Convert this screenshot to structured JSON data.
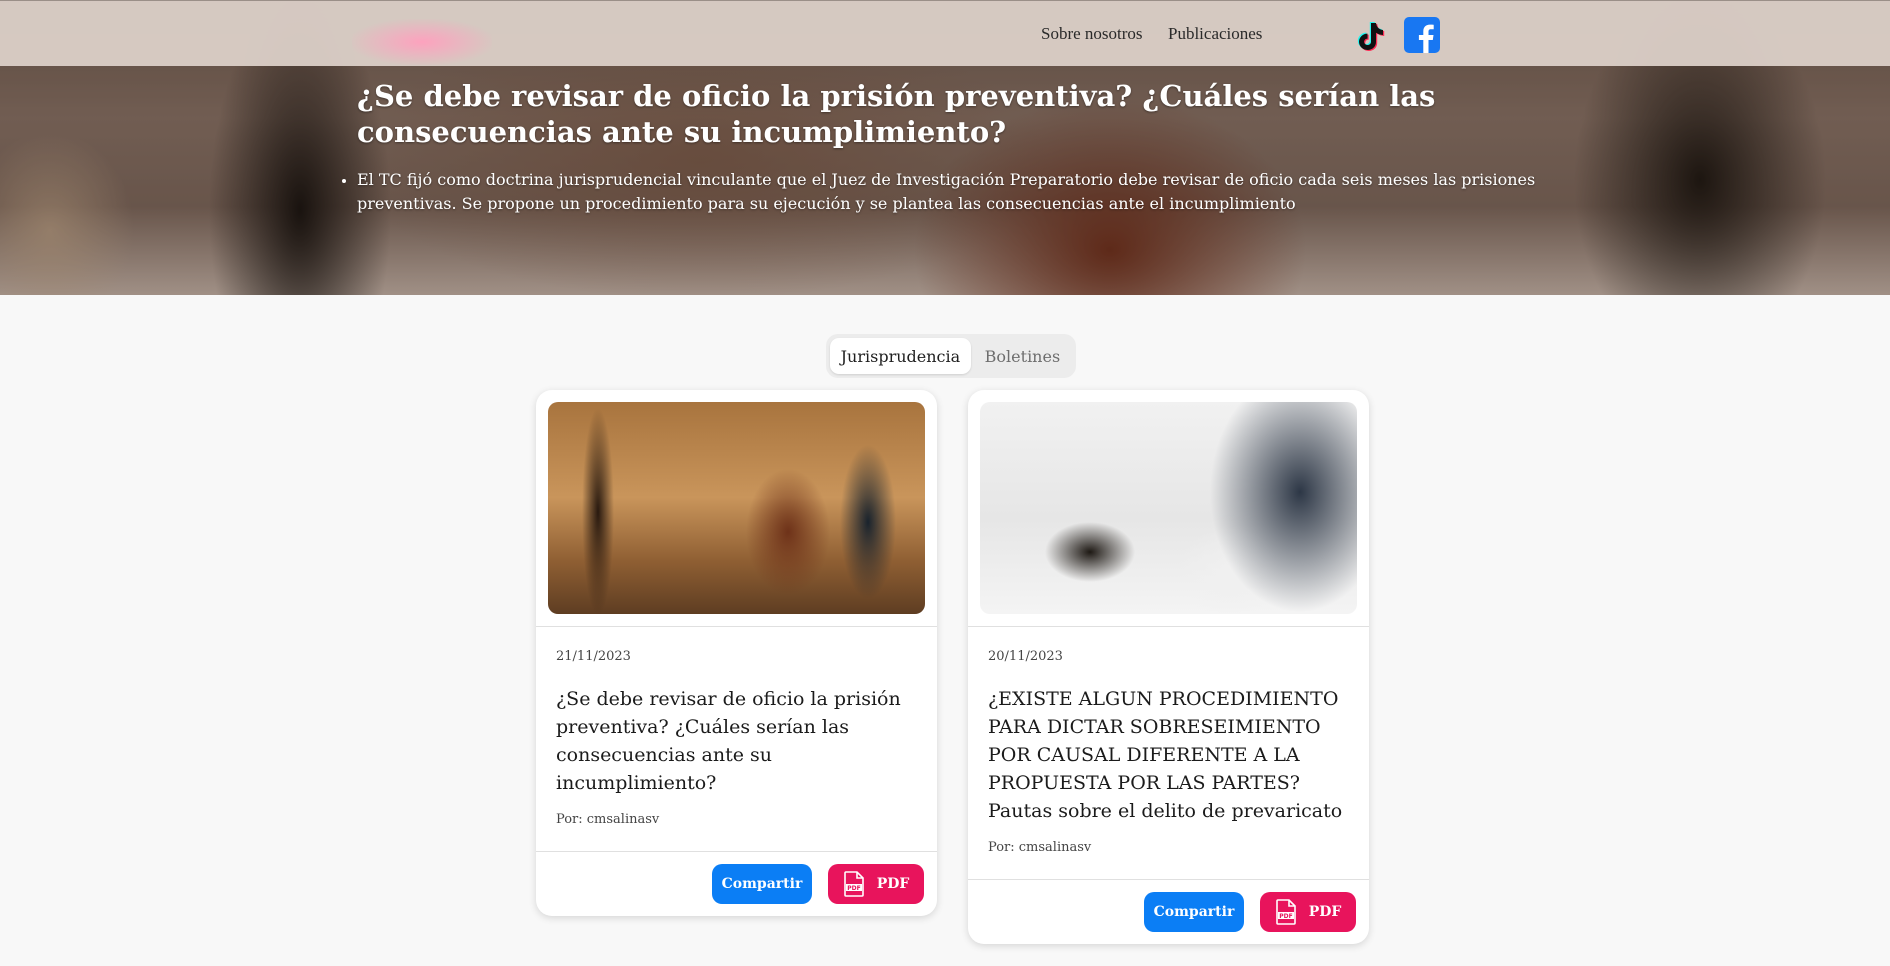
{
  "nav": {
    "about": "Sobre nosotros",
    "publications": "Publicaciones"
  },
  "hero": {
    "title": "¿Se debe revisar de oficio la prisión preventiva? ¿Cuáles serían las consecuencias ante su incumplimiento?",
    "bullet": "El TC fijó como doctrina jurisprudencial vinculante que el Juez de Investigación Preparatorio debe revisar de oficio cada seis meses las prisiones preventivas. Se propone un procedimiento para su ejecución y se plantea las consecuencias ante el incumplimiento"
  },
  "tabs": [
    {
      "label": "Jurisprudencia",
      "active": true
    },
    {
      "label": "Boletines",
      "active": false
    }
  ],
  "cards": [
    {
      "date": "21/11/2023",
      "title": "¿Se debe revisar de oficio la prisión preventiva? ¿Cuáles serían las consecuencias ante su incumplimiento?",
      "author": "Por: cmsalinasv",
      "share_label": "Compartir",
      "pdf_label": "PDF"
    },
    {
      "date": "20/11/2023",
      "title": "¿EXISTE ALGUN PROCEDIMIENTO PARA DICTAR SOBRESEIMIENTO POR CAUSAL DIFERENTE A LA PROPUESTA POR LAS PARTES? Pautas sobre el delito de prevaricato",
      "author": "Por: cmsalinasv",
      "share_label": "Compartir",
      "pdf_label": "PDF"
    }
  ],
  "icons": {
    "social": [
      "tiktok-icon",
      "facebook-icon"
    ],
    "pdf": "pdf-file-icon"
  },
  "colors": {
    "share_button": "#0b7ef5",
    "pdf_button": "#e8145c",
    "facebook": "#1877f2"
  }
}
